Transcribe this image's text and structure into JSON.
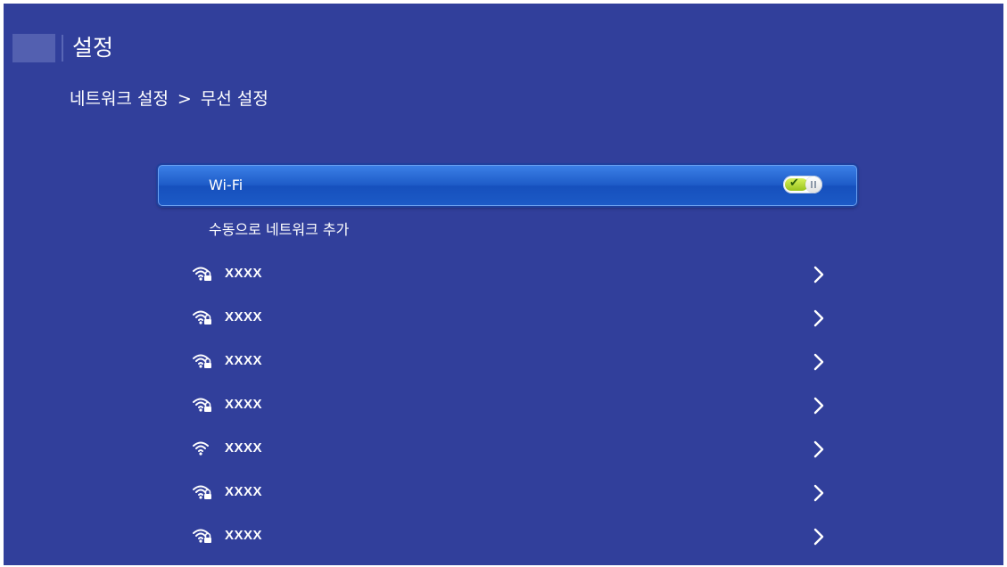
{
  "header": {
    "title": "설정"
  },
  "breadcrumb": {
    "parent": "네트워크 설정",
    "separator": ">",
    "current": "무선 설정"
  },
  "wifi": {
    "label": "Wi-Fi",
    "enabled": true,
    "check_glyph": "✔"
  },
  "manual_add": {
    "label": "수동으로 네트워크 추가"
  },
  "networks": [
    {
      "name": "XXXX",
      "icon": "wifi-lock-icon"
    },
    {
      "name": "XXXX",
      "icon": "wifi-lock-icon"
    },
    {
      "name": "XXXX",
      "icon": "wifi-lock-icon"
    },
    {
      "name": "XXXX",
      "icon": "wifi-lock-icon"
    },
    {
      "name": "XXXX",
      "icon": "wifi-icon"
    },
    {
      "name": "XXXX",
      "icon": "wifi-lock-icon"
    },
    {
      "name": "XXXX",
      "icon": "wifi-lock-icon"
    }
  ],
  "colors": {
    "background": "#313f9b",
    "selected_row": "#1e5cc8",
    "toggle_on": "#b8dc35",
    "text": "#ffffff"
  }
}
